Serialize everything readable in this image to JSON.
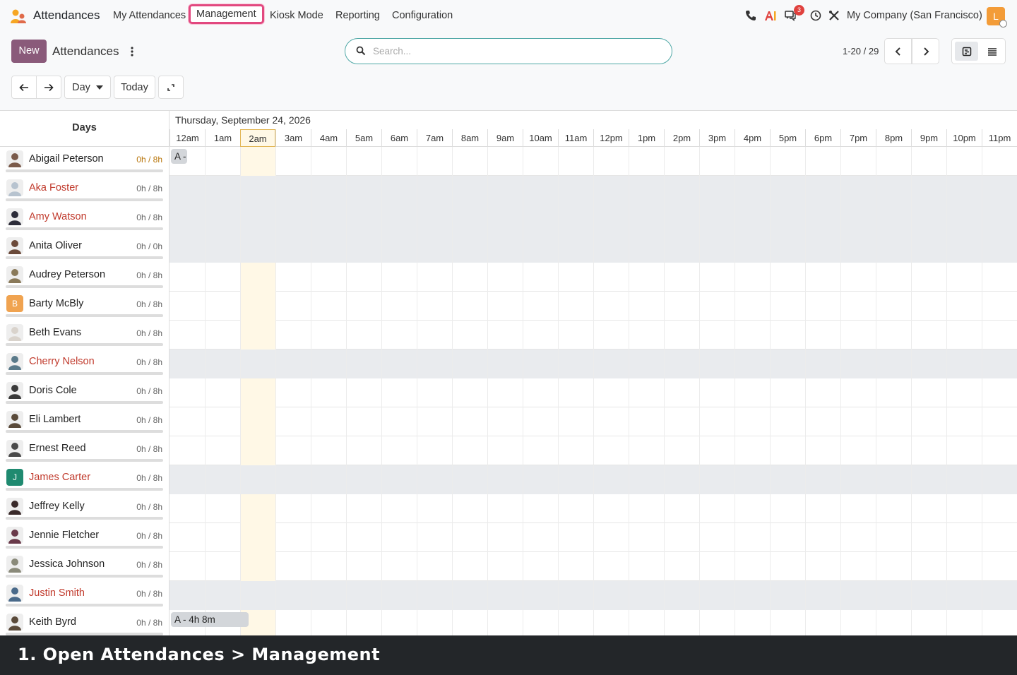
{
  "app": {
    "name": "Attendances"
  },
  "menu": [
    {
      "label": "My Attendances"
    },
    {
      "label": "Management",
      "active": true
    },
    {
      "label": "Kiosk Mode"
    },
    {
      "label": "Reporting"
    },
    {
      "label": "Configuration"
    }
  ],
  "systray": {
    "messages_badge": "3",
    "company": "My Company (San Francisco)",
    "user_initial": "L"
  },
  "control": {
    "new_label": "New",
    "breadcrumb": "Attendances",
    "search_placeholder": "Search...",
    "pager": "1-20 / 29",
    "scale_label": "Day",
    "today_label": "Today"
  },
  "gantt": {
    "days_header": "Days",
    "date_title": "Thursday, September 24, 2026",
    "hours": [
      "12am",
      "1am",
      "2am",
      "3am",
      "4am",
      "5am",
      "6am",
      "7am",
      "8am",
      "9am",
      "10am",
      "11am",
      "12pm",
      "1pm",
      "2pm",
      "3pm",
      "4pm",
      "5pm",
      "6pm",
      "7pm",
      "8pm",
      "9pm",
      "10pm",
      "11pm"
    ],
    "current_hour": "2am",
    "rows": [
      {
        "name": "Abigail Peterson",
        "hours": "0h / 8h",
        "warn": true,
        "off": false,
        "grey": false,
        "avatar": "photo",
        "avatar_color": "#7a5a4a",
        "pill": "A -",
        "pill_start_hour": 0,
        "pill_duration_hours": 0.45
      },
      {
        "name": "Aka Foster",
        "hours": "0h / 8h",
        "off": true,
        "grey": true,
        "avatar": "photo",
        "avatar_color": "#b7c3cf"
      },
      {
        "name": "Amy Watson",
        "hours": "0h / 8h",
        "off": true,
        "grey": true,
        "avatar": "photo",
        "avatar_color": "#2d2d3a"
      },
      {
        "name": "Anita Oliver",
        "hours": "0h / 0h",
        "off": false,
        "grey": true,
        "avatar": "photo",
        "avatar_color": "#6b4a3a"
      },
      {
        "name": "Audrey Peterson",
        "hours": "0h / 8h",
        "off": false,
        "grey": false,
        "avatar": "photo",
        "avatar_color": "#8a7a5a"
      },
      {
        "name": "Barty McBly",
        "hours": "0h / 8h",
        "off": false,
        "grey": false,
        "avatar": "initial",
        "initial": "B",
        "avatar_color": "#f0a350"
      },
      {
        "name": "Beth Evans",
        "hours": "0h / 8h",
        "off": false,
        "grey": false,
        "avatar": "photo",
        "avatar_color": "#d9d3cc"
      },
      {
        "name": "Cherry Nelson",
        "hours": "0h / 8h",
        "off": true,
        "grey": true,
        "avatar": "photo",
        "avatar_color": "#5a7a8a"
      },
      {
        "name": "Doris Cole",
        "hours": "0h / 8h",
        "off": false,
        "grey": false,
        "avatar": "photo",
        "avatar_color": "#3a3a3a"
      },
      {
        "name": "Eli Lambert",
        "hours": "0h / 8h",
        "off": false,
        "grey": false,
        "avatar": "photo",
        "avatar_color": "#5a4a3a"
      },
      {
        "name": "Ernest Reed",
        "hours": "0h / 8h",
        "off": false,
        "grey": false,
        "avatar": "photo",
        "avatar_color": "#4a4a4a"
      },
      {
        "name": "James Carter",
        "hours": "0h / 8h",
        "off": true,
        "grey": true,
        "avatar": "initial",
        "initial": "J",
        "avatar_color": "#1f8a70"
      },
      {
        "name": "Jeffrey Kelly",
        "hours": "0h / 8h",
        "off": false,
        "grey": false,
        "avatar": "photo",
        "avatar_color": "#3a2a2a"
      },
      {
        "name": "Jennie Fletcher",
        "hours": "0h / 8h",
        "off": false,
        "grey": false,
        "avatar": "photo",
        "avatar_color": "#6a3a4a"
      },
      {
        "name": "Jessica Johnson",
        "hours": "0h / 8h",
        "off": false,
        "grey": false,
        "avatar": "photo",
        "avatar_color": "#8a8a7a"
      },
      {
        "name": "Justin Smith",
        "hours": "0h / 8h",
        "off": true,
        "grey": true,
        "avatar": "photo",
        "avatar_color": "#4a6a8a"
      },
      {
        "name": "Keith Byrd",
        "hours": "0h / 8h",
        "off": false,
        "grey": false,
        "avatar": "photo",
        "avatar_color": "#5a4a3a",
        "pill": "A - 4h 8m",
        "pill_start_hour": 0,
        "pill_duration_hours": 2.2
      }
    ]
  },
  "caption": "1. Open Attendances > Management",
  "colors": {
    "accent": "#8a5a7a",
    "highlight": "#e2487f",
    "now_column": "#fff8e6"
  }
}
